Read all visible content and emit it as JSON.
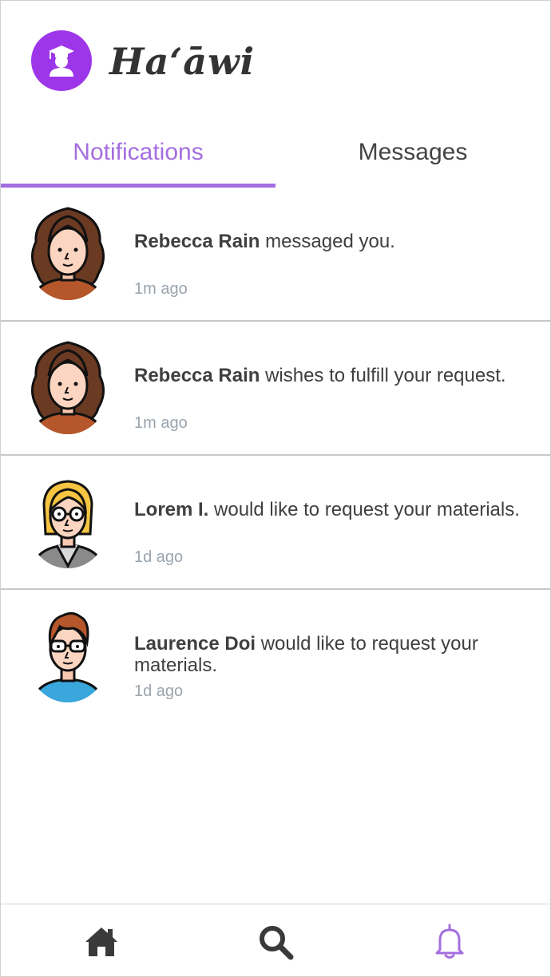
{
  "app": {
    "title": "Haʻāwi"
  },
  "tabs": [
    {
      "label": "Notifications",
      "active": true
    },
    {
      "label": "Messages",
      "active": false
    }
  ],
  "notifications": [
    {
      "name": "Rebecca Rain",
      "text": " messaged you.",
      "time": "1m ago",
      "avatar": "woman-brown-hair-avatar"
    },
    {
      "name": "Rebecca Rain",
      "text": " wishes to fulfill your request.",
      "time": "1m ago",
      "avatar": "woman-brown-hair-avatar"
    },
    {
      "name": "Lorem I.",
      "text": " would like to request your materials.",
      "time": "1d ago",
      "avatar": "woman-blonde-glasses-avatar"
    },
    {
      "name": "Laurence Doi",
      "text": " would like to request your materials.",
      "time": "1d ago",
      "avatar": "man-glasses-avatar"
    }
  ],
  "bottom_nav": [
    {
      "icon": "home-icon"
    },
    {
      "icon": "search-icon"
    },
    {
      "icon": "bell-icon",
      "active": true
    }
  ],
  "colors": {
    "accent": "#a46ee0",
    "logo": "#9d36e8",
    "text": "#3f3f3f",
    "muted": "#9aa4ad"
  }
}
